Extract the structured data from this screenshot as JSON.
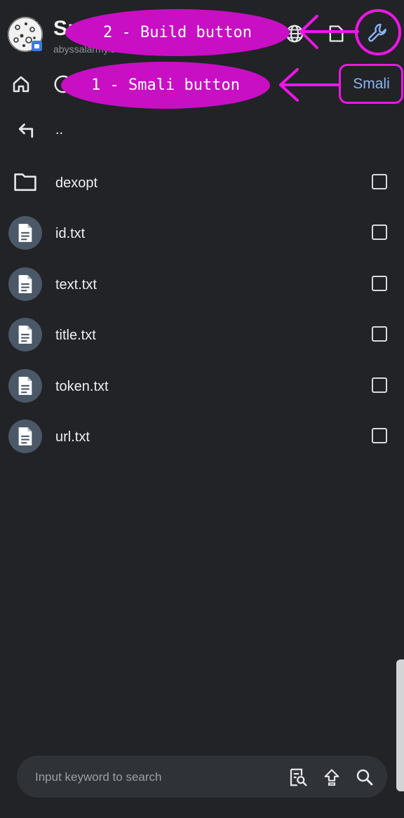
{
  "header": {
    "title": "SmsEye",
    "subtitle": "abyssalarmy.s"
  },
  "toolbar": {
    "smali_label": "Smali"
  },
  "file_list": {
    "parent_label": "..",
    "items": [
      {
        "name": "dexopt",
        "type": "folder"
      },
      {
        "name": "id.txt",
        "type": "file"
      },
      {
        "name": "text.txt",
        "type": "file"
      },
      {
        "name": "title.txt",
        "type": "file"
      },
      {
        "name": "token.txt",
        "type": "file"
      },
      {
        "name": "url.txt",
        "type": "file"
      }
    ]
  },
  "search": {
    "placeholder": "Input keyword to search"
  },
  "annotations": {
    "build_label": "2 - Build button",
    "smali_label": "1 - Smali button",
    "color": "#c80fc4",
    "arrow_color": "#ee16e6"
  },
  "colors": {
    "background": "#212326",
    "accent": "#8ab4f8",
    "file_icon_bg": "#4b5868"
  }
}
